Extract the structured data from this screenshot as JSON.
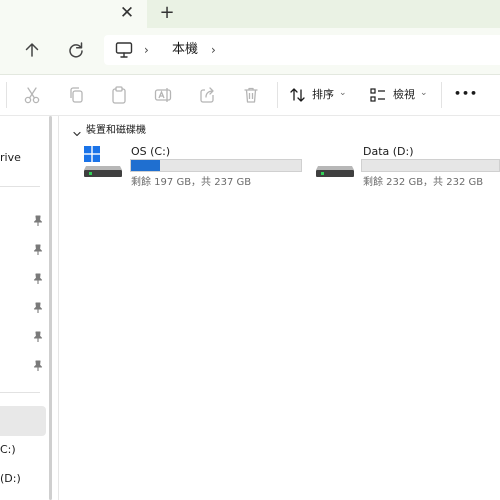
{
  "titlebar": {
    "close_glyph": "✕",
    "new_tab_glyph": "+"
  },
  "address": {
    "location": "本機",
    "separator": "›"
  },
  "toolbar": {
    "sort_label": "排序",
    "view_label": "檢視",
    "more_glyph": "•••",
    "dropdown_glyph": "⌄"
  },
  "sidebar": {
    "partial_onedrive": "rive",
    "partial_c": "C:)",
    "partial_d": "(D:)"
  },
  "main": {
    "group_title": "裝置和磁碟機",
    "drives": [
      {
        "name": "OS (C:)",
        "detail": "剩餘 197 GB，共 237 GB",
        "used_fraction": 0.169
      },
      {
        "name": "Data (D:)",
        "detail": "剩餘 232 GB，共 232 GB",
        "used_fraction": 0.0
      }
    ]
  },
  "colors": {
    "accent": "#1f6fd0",
    "titlebar": "#eaf2e4"
  }
}
